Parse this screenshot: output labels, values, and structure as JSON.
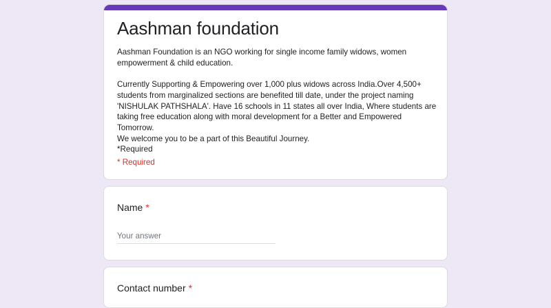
{
  "form": {
    "accent_color": "#673ab7",
    "background_color": "#ede7f6",
    "title": "Aashman foundation",
    "description": {
      "intro": "Aashman Foundation is an NGO working for single income family widows, women empowerment & child education.",
      "body": "Currently Supporting & Empowering over  1,000 plus widows across India.Over 4,500+ students from marginalized sections are benefited  till date, under the project naming 'NISHULAK PATHSHALA'. Have 16 schools in 11 states all over India, Where students are taking free  education along with moral development for a Better and Empowered Tomorrow.",
      "welcome": "We welcome you to be a part of  this Beautiful Journey.",
      "required_line": "*Required"
    },
    "required_note": "* Required"
  },
  "questions": [
    {
      "label": "Name",
      "required_mark": "*",
      "value": "",
      "placeholder": "Your answer"
    },
    {
      "label": "Contact number",
      "required_mark": "*"
    }
  ]
}
